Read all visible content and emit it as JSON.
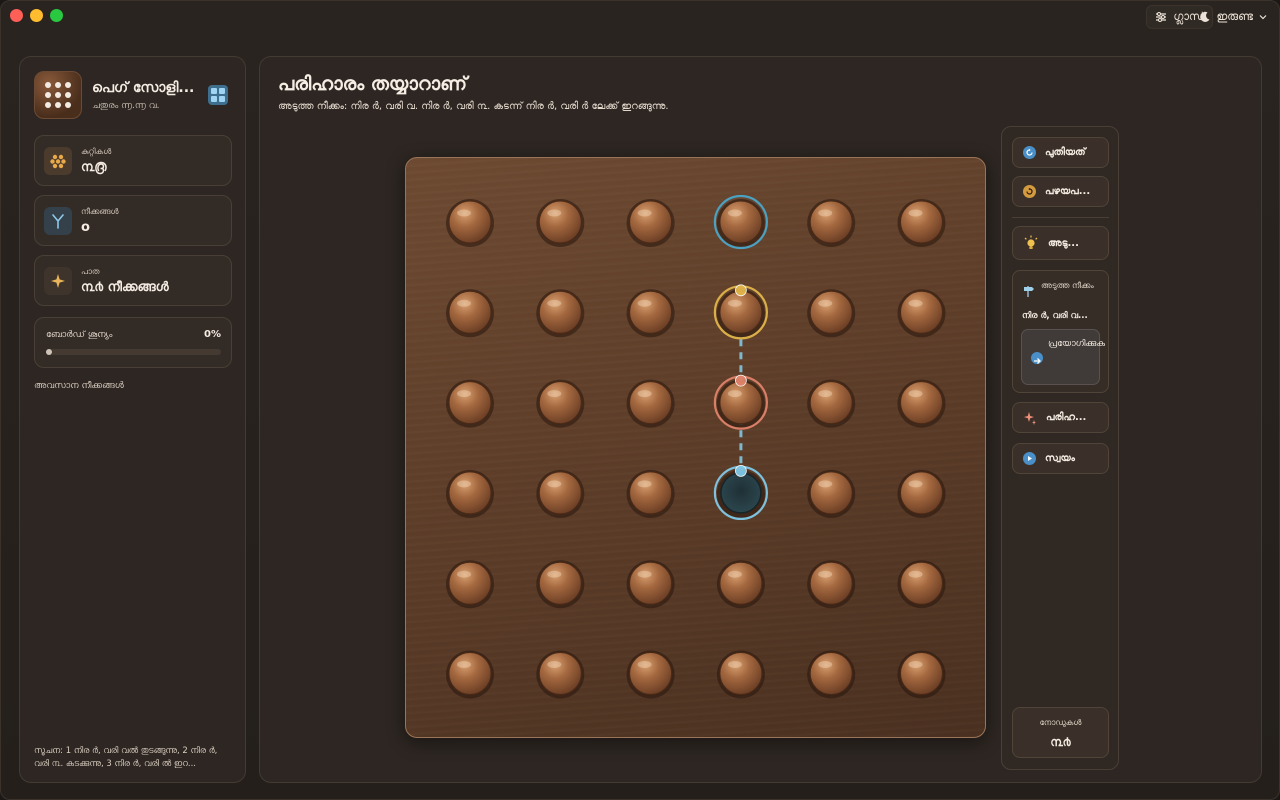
{
  "topbar": {
    "glass_label": "ഗ്ലാസ്",
    "theme_label": "ഇരുണ്ട"
  },
  "sidebar": {
    "brand_title": "പെഗ് സോളി...",
    "brand_subtitle": "ചതുരം ൬.൬ വ.",
    "stats": [
      {
        "label": "കുറ്റികൾ",
        "value": "൩൫",
        "icon": "pegs-icon"
      },
      {
        "label": "നീക്കങ്ങൾ",
        "value": "o",
        "icon": "moves-icon"
      },
      {
        "label": "പാത",
        "value": "൩൪ നീക്കങ്ങൾ",
        "icon": "sparkle-icon"
      }
    ],
    "progress": {
      "label": "ബോർഡ് ശൂന്യം",
      "percent_label": "0%",
      "value": 0
    },
    "recent_title": "അവസാന നീക്കങ്ങൾ",
    "hint": "സൂചന: 1 നിര ർ, വരി വൽ തുടങ്ങുന്നു, 2 നിര ർ, വരി ൩. കടക്കുന്നു, 3 നിര ർ, വരി ൽ ഇറ..."
  },
  "main": {
    "title": "പരിഹാരം തയ്യാറാണ്",
    "subtitle": "അടുത്ത നീക്കം: നിര ർ, വരി വ. നിര ർ, വരി ൩. കടന്ന് നിര ർ, വരി ർ ലേക്ക് ഇറങ്ങുന്നു."
  },
  "board": {
    "rows": 6,
    "cols": 6,
    "empty_holes": [
      [
        3,
        3
      ]
    ],
    "highlight_from": [
      1,
      3
    ],
    "highlight_over": [
      2,
      3
    ],
    "highlight_to": [
      3,
      3
    ],
    "selected": [
      0,
      3
    ],
    "colors": {
      "peg": "#9a5f38",
      "from_ring": "#e2b54a",
      "over_ring": "#e0836a",
      "to_ring": "#7fc8e8",
      "selected_ring": "#4aa6c9"
    }
  },
  "controls": {
    "new_label": "പുതിയത്",
    "old_label": "പഴയപ...",
    "next_label": "അടു...",
    "next_card_label": "അടുത്ത നീക്കം",
    "next_card_value": "നിര ർ, വരി വ...",
    "apply_label": "പ്രയോഗിക്കുക",
    "solve_label": "പരിഹ...",
    "auto_label": "സ്വയം",
    "nodes_label": "നോഡുകൾ",
    "nodes_value": "൩൪"
  }
}
